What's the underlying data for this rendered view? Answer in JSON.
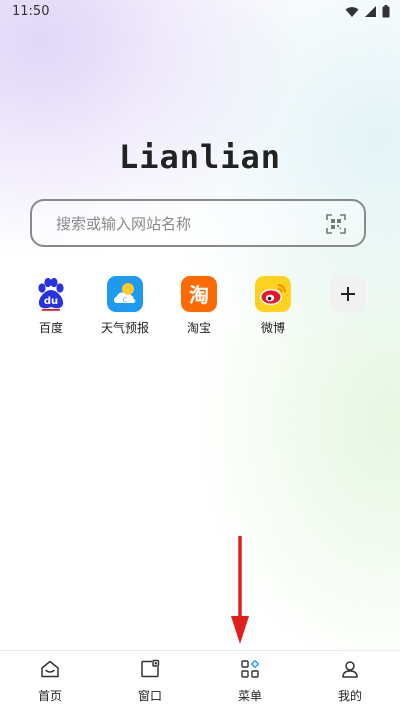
{
  "status_bar": {
    "time": "11:50"
  },
  "brand": {
    "title": "Lianlian"
  },
  "search": {
    "placeholder": "搜索或输入网站名称"
  },
  "shortcuts": [
    {
      "label": "百度",
      "icon": "baidu-paw-icon"
    },
    {
      "label": "天气预报",
      "icon": "weather-icon"
    },
    {
      "label": "淘宝",
      "icon": "taobao-icon"
    },
    {
      "label": "微博",
      "icon": "weibo-icon"
    }
  ],
  "add_shortcut": {
    "icon": "plus-icon"
  },
  "bottom_nav": [
    {
      "label": "首页",
      "icon": "home-icon"
    },
    {
      "label": "窗口",
      "icon": "window-icon"
    },
    {
      "label": "菜单",
      "icon": "menu-grid-icon"
    },
    {
      "label": "我的",
      "icon": "user-icon"
    }
  ],
  "colors": {
    "accent_red": "#e02020",
    "taobao_orange": "#ff6a00",
    "weather_blue": "#1e9bf0",
    "baidu_blue": "#2932e1"
  }
}
